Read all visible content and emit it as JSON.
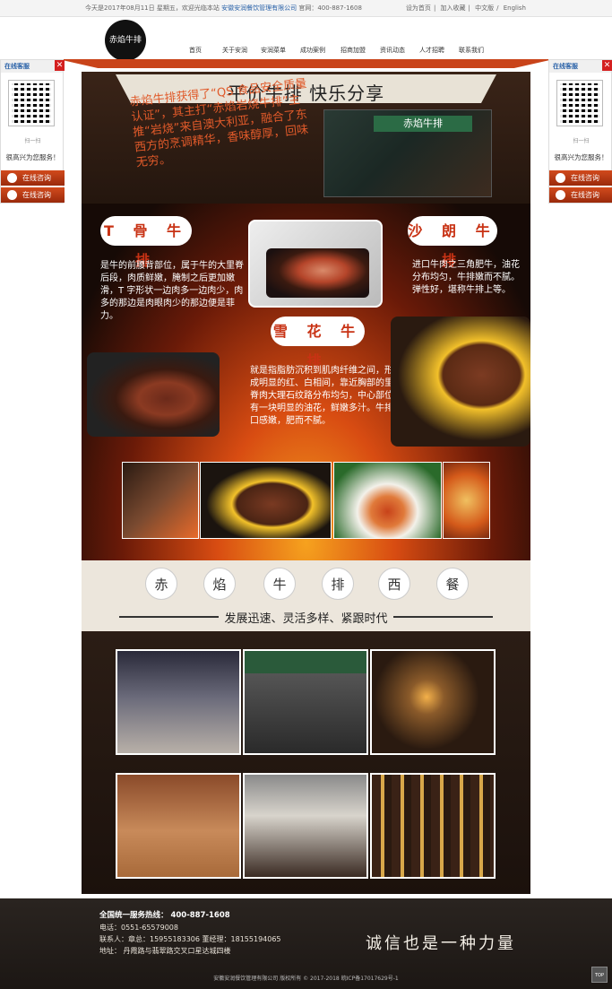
{
  "topbar": {
    "greeting": "今天是2017年08月11日 星期五，欢迎光临本站",
    "company": "安徽安润餐饮管理有限公司",
    "hotline": "官网：400-887-1608",
    "links": [
      "设为首页",
      "加入收藏",
      "中文版",
      "English"
    ]
  },
  "header": {
    "logo_text": "赤焰牛排",
    "nav": [
      "首页",
      "关于安润",
      "安润菜单",
      "成功案例",
      "招商加盟",
      "资讯动态",
      "人才招聘",
      "联系我们"
    ]
  },
  "sidebar": {
    "title": "在线客服",
    "close": "✕",
    "scan": "扫一扫",
    "serve": "很高兴为您服务！",
    "btn1": "在线咨询",
    "btn2": "在线咨询"
  },
  "banner": {
    "heading": "平价牛排  快乐分享",
    "intro": "赤焰牛排获得了“QS 食品安全质量认证”，其主打“赤焰岩烧牛排”主推“岩烧”来自澳大利亚，融合了东西方的烹调精华，香味醇厚，回味无穷。",
    "store_sign": "赤焰牛排"
  },
  "dishes": [
    {
      "name": "T 骨 牛 排",
      "desc": "是牛的前腰背部位，属于牛的大里脊后段，肉质鲜嫩，腌制之后更加嫩滑，T 字形状一边肉多一边肉少，肉多的那边是肉眼肉少的那边便是菲力。"
    },
    {
      "name": "沙 朗 牛 排",
      "desc": "进口牛肉之三角肥牛，油花分布均匀，牛排嫩而不腻。弹性好，堪称牛排上等。"
    },
    {
      "name": "雪 花 牛 排",
      "desc": "就是指脂肪沉积到肌肉纤维之间，形成明显的红、白相间，靠近胸部的里脊肉大理石纹路分布均匀，中心部位有一块明显的油花，鲜嫩多汁。牛排口感嫩，肥而不腻。"
    }
  ],
  "slogan": {
    "chars": [
      "赤",
      "焰",
      "牛",
      "排",
      "西",
      "餐"
    ],
    "sub": "发展迅速、灵活多样、紧跟时代"
  },
  "footer": {
    "hotline": "全国统一服务热线：  400-887-1608",
    "phone": "电话：0551-65579008",
    "contacts": "联系人：章总：15955183306  董经理：18155194065",
    "address": "地址：  丹霞路与翡翠路交叉口星达城四楼",
    "motto": "诚信也是一种力量",
    "copyright": "安徽安润餐饮管理有限公司 版权所有 © 2017-2018  皖ICP备17017629号-1",
    "totop": "TOP"
  },
  "colors": {
    "accent": "#c9441a",
    "fire": "#d84c12",
    "link": "#2a62a8"
  }
}
